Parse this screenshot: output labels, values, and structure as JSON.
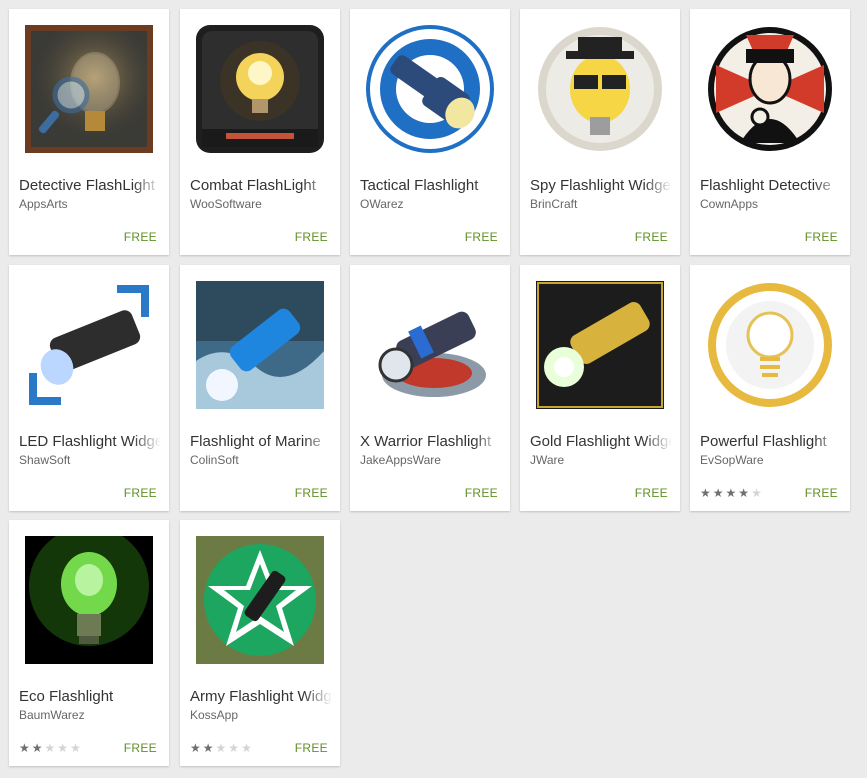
{
  "apps": [
    {
      "title": "Detective FlashLight",
      "developer": "AppsArts",
      "price": "FREE",
      "icon": "detective-lightbulb-magnifier-icon",
      "rating": null
    },
    {
      "title": "Combat FlashLight",
      "developer": "WooSoftware",
      "price": "FREE",
      "icon": "combat-lightbulb-icon",
      "rating": null
    },
    {
      "title": "Tactical Flashlight",
      "developer": "OWarez",
      "price": "FREE",
      "icon": "tactical-flashlight-icon",
      "rating": null
    },
    {
      "title": "Spy Flashlight Widget",
      "developer": "BrinCraft",
      "price": "FREE",
      "icon": "spy-lightbulb-icon",
      "rating": null
    },
    {
      "title": "Flashlight Detective",
      "developer": "CownApps",
      "price": "FREE",
      "icon": "detective-policeman-icon",
      "rating": null
    },
    {
      "title": "LED Flashlight Widget",
      "developer": "ShawSoft",
      "price": "FREE",
      "icon": "led-flashlight-icon",
      "rating": null
    },
    {
      "title": "Flashlight of Marine",
      "developer": "ColinSoft",
      "price": "FREE",
      "icon": "marine-flashlight-icon",
      "rating": null
    },
    {
      "title": "X Warrior Flashlight",
      "developer": "JakeAppsWare",
      "price": "FREE",
      "icon": "warrior-flashlight-icon",
      "rating": null
    },
    {
      "title": "Gold Flashlight Widget",
      "developer": "JWare",
      "price": "FREE",
      "icon": "gold-flashlight-icon",
      "rating": null
    },
    {
      "title": "Powerful Flashlight",
      "developer": "EvSopWare",
      "price": "FREE",
      "icon": "powerful-lightbulb-icon",
      "rating": 4
    },
    {
      "title": "Eco Flashlight",
      "developer": "BaumWarez",
      "price": "FREE",
      "icon": "eco-green-lightbulb-icon",
      "rating": 2
    },
    {
      "title": "Army Flashlight Widget",
      "developer": "KossApp",
      "price": "FREE",
      "icon": "army-star-flashlight-icon",
      "rating": 2
    }
  ],
  "colors": {
    "price": "#5f8f26",
    "background": "#ebebeb",
    "card": "#ffffff"
  }
}
